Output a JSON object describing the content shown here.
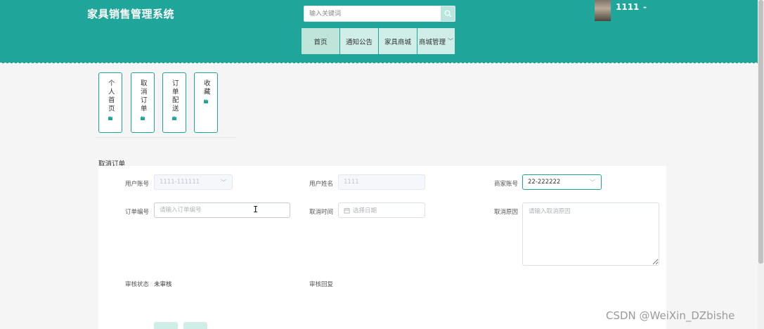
{
  "header": {
    "site_title": "家具销售管理系统",
    "search_placeholder": "输入关键词",
    "user_name": "1111",
    "user_suffix": "-",
    "nav": [
      {
        "label": "首页"
      },
      {
        "label": "通知公告"
      },
      {
        "label": "家具商城"
      },
      {
        "label": "商城管理"
      }
    ]
  },
  "side_tabs": [
    {
      "label": "个人首页"
    },
    {
      "label": "取消订单"
    },
    {
      "label": "订单配送"
    },
    {
      "label": "收藏"
    }
  ],
  "form": {
    "section_title": "取消订单",
    "user_account_label": "用户账号",
    "user_account_value": "1111-111111",
    "user_name_label": "用户姓名",
    "user_name_value": "1111",
    "merchant_account_label": "商家账号",
    "merchant_account_value": "22-222222",
    "order_no_label": "订单编号",
    "order_no_placeholder": "请输入订单编号",
    "cancel_time_label": "取消时间",
    "cancel_time_placeholder": "选择日期",
    "cancel_reason_label": "取消原因",
    "cancel_reason_placeholder": "请输入取消原因",
    "review_status_label": "审核状态",
    "review_status_value": "未审核",
    "review_reply_label": "审核回复"
  },
  "watermark": "CSDN @WeiXin_DZbishe",
  "colors": {
    "header_bg": "#1fa59a",
    "nav_bg": "#cfeee7",
    "accent": "#1fa59a"
  }
}
